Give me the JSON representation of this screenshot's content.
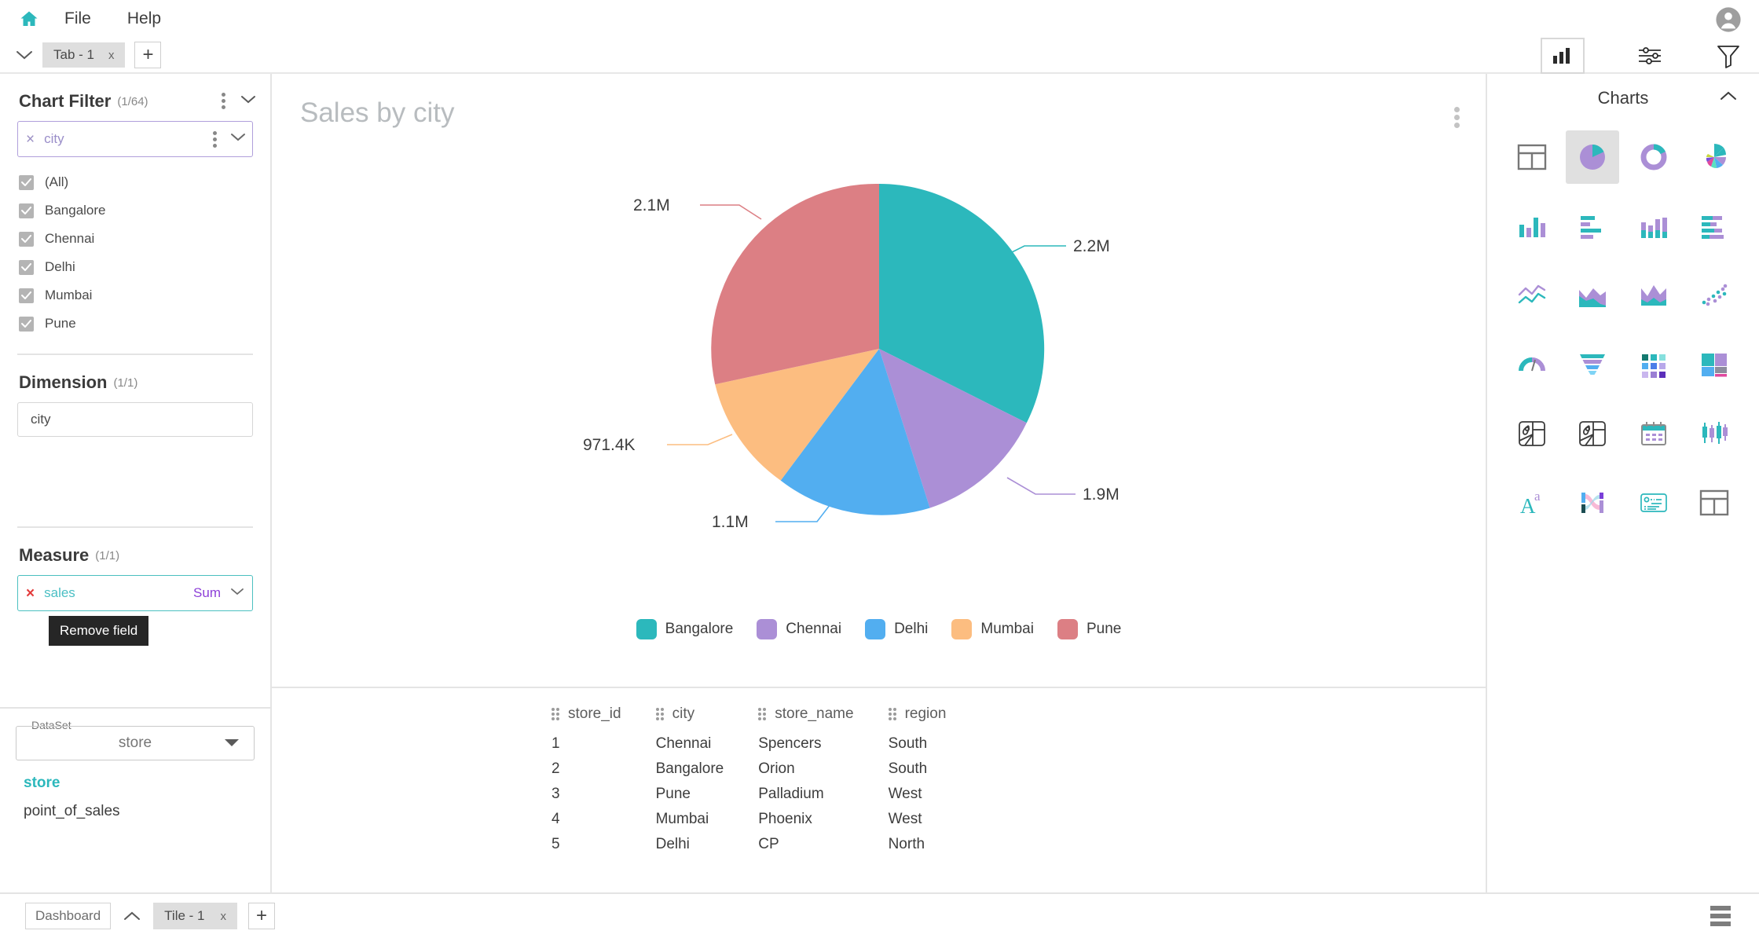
{
  "app": {
    "home_icon": "home-icon",
    "menus": [
      "File",
      "Help"
    ],
    "avatar_icon": "user-avatar-icon"
  },
  "tabbar": {
    "collapse_icon": "chevron-down-icon",
    "tabs": [
      {
        "label": "Tab - 1",
        "close": "x"
      }
    ],
    "add_label": "+",
    "tools": [
      {
        "name": "chart-view-toggle",
        "icon": "bar-chart-icon",
        "selected": true
      },
      {
        "name": "settings-toggle",
        "icon": "sliders-icon",
        "selected": false
      },
      {
        "name": "filter-toggle",
        "icon": "funnel-icon",
        "selected": false
      }
    ]
  },
  "left_panel": {
    "chart_filter": {
      "title": "Chart Filter",
      "count": "(1/64)",
      "menu_icon": "more-vertical-icon",
      "chevron_icon": "chevron-down-icon",
      "field": {
        "remove": "×",
        "label": "city",
        "menu_icon": "more-vertical-icon",
        "chevron_icon": "chevron-down-icon"
      },
      "options": [
        {
          "label": "(All)",
          "checked": true
        },
        {
          "label": "Bangalore",
          "checked": true
        },
        {
          "label": "Chennai",
          "checked": true
        },
        {
          "label": "Delhi",
          "checked": true
        },
        {
          "label": "Mumbai",
          "checked": true
        },
        {
          "label": "Pune",
          "checked": true
        }
      ]
    },
    "dimension": {
      "title": "Dimension",
      "count": "(1/1)",
      "field_label": "city"
    },
    "measure": {
      "title": "Measure",
      "count": "(1/1)",
      "remove": "×",
      "field_label": "sales",
      "aggregation": "Sum",
      "chevron_icon": "chevron-down-icon",
      "tooltip": "Remove field"
    },
    "dataset": {
      "legend": "DataSet",
      "selected": "store",
      "caret_icon": "caret-down-icon",
      "items": [
        {
          "label": "store",
          "active": true
        },
        {
          "label": "point_of_sales",
          "active": false
        }
      ]
    }
  },
  "chart": {
    "title": "Sales by city",
    "menu_icon": "more-vertical-icon"
  },
  "chart_data": {
    "type": "pie",
    "title": "Sales by city",
    "categories": [
      "Bangalore",
      "Chennai",
      "Delhi",
      "Mumbai",
      "Pune"
    ],
    "values": [
      2200000,
      1900000,
      1100000,
      971400,
      2100000
    ],
    "labels": [
      "2.2M",
      "1.9M",
      "1.1M",
      "971.4K",
      "2.1M"
    ],
    "colors": [
      "#2cb8bc",
      "#ab8fd6",
      "#52aef0",
      "#fcbd80",
      "#dc7f84"
    ],
    "legend_position": "bottom",
    "measure": "sales",
    "aggregation": "Sum",
    "dimension": "city"
  },
  "right_panel": {
    "title": "Charts",
    "collapse_icon": "chevron-up-icon",
    "charts": [
      {
        "name": "grid-table-icon",
        "selected": false
      },
      {
        "name": "pie-chart-icon",
        "selected": true
      },
      {
        "name": "donut-chart-icon",
        "selected": false
      },
      {
        "name": "rose-chart-icon",
        "selected": false
      },
      {
        "name": "column-chart-icon",
        "selected": false
      },
      {
        "name": "bar-chart-icon",
        "selected": false
      },
      {
        "name": "stacked-column-chart-icon",
        "selected": false
      },
      {
        "name": "stacked-bar-chart-icon",
        "selected": false
      },
      {
        "name": "line-chart-icon",
        "selected": false
      },
      {
        "name": "area-chart-icon",
        "selected": false
      },
      {
        "name": "stacked-area-chart-icon",
        "selected": false
      },
      {
        "name": "scatter-chart-icon",
        "selected": false
      },
      {
        "name": "gauge-chart-icon",
        "selected": false
      },
      {
        "name": "funnel-chart-icon",
        "selected": false
      },
      {
        "name": "heatmap-chart-icon",
        "selected": false
      },
      {
        "name": "treemap-chart-icon",
        "selected": false
      },
      {
        "name": "map-chart-icon",
        "selected": false
      },
      {
        "name": "map-bubble-chart-icon",
        "selected": false
      },
      {
        "name": "calendar-chart-icon",
        "selected": false
      },
      {
        "name": "candlestick-chart-icon",
        "selected": false
      },
      {
        "name": "word-cloud-icon",
        "selected": false
      },
      {
        "name": "sankey-chart-icon",
        "selected": false
      },
      {
        "name": "kpi-card-icon",
        "selected": false
      },
      {
        "name": "pivot-table-icon",
        "selected": false
      }
    ]
  },
  "data_table": {
    "columns": [
      "store_id",
      "city",
      "store_name",
      "region"
    ],
    "rows": [
      [
        "1",
        "Chennai",
        "Spencers",
        "South"
      ],
      [
        "2",
        "Bangalore",
        "Orion",
        "South"
      ],
      [
        "3",
        "Pune",
        "Palladium",
        "West"
      ],
      [
        "4",
        "Mumbai",
        "Phoenix",
        "West"
      ],
      [
        "5",
        "Delhi",
        "CP",
        "North"
      ]
    ]
  },
  "bottombar": {
    "dashboard_label": "Dashboard",
    "chevron_icon": "chevron-up-icon",
    "tiles": [
      {
        "label": "Tile - 1",
        "close": "x"
      }
    ],
    "add_label": "+",
    "menu_icon": "hamburger-icon"
  },
  "theme": {
    "accent_teal": "#2cb8bc",
    "accent_purple": "#ab8fd6",
    "accent_blue": "#52aef0",
    "accent_orange": "#fcbd80",
    "accent_rose": "#dc7f84",
    "remove_red": "#e33b3b",
    "agg_purple": "#8d40d8"
  }
}
